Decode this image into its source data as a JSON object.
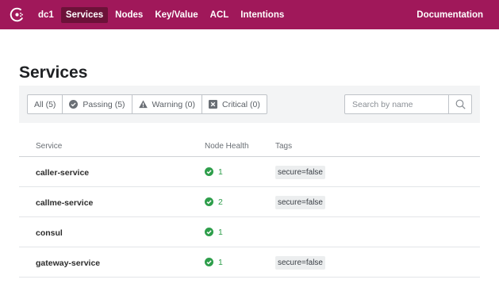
{
  "nav": {
    "logo_icon": "consul-logo-icon",
    "datacenter": "dc1",
    "items": [
      {
        "label": "Services",
        "active": true
      },
      {
        "label": "Nodes",
        "active": false
      },
      {
        "label": "Key/Value",
        "active": false
      },
      {
        "label": "ACL",
        "active": false
      },
      {
        "label": "Intentions",
        "active": false
      }
    ],
    "documentation": "Documentation"
  },
  "page": {
    "title": "Services"
  },
  "filters": {
    "all": "All (5)",
    "passing": "Passing (5)",
    "warning": "Warning (0)",
    "critical": "Critical (0)"
  },
  "search": {
    "placeholder": "Search by name",
    "value": ""
  },
  "table": {
    "headers": {
      "service": "Service",
      "health": "Node Health",
      "tags": "Tags"
    },
    "rows": [
      {
        "name": "caller-service",
        "health": "1",
        "tag": "secure=false"
      },
      {
        "name": "callme-service",
        "health": "2",
        "tag": "secure=false"
      },
      {
        "name": "consul",
        "health": "1",
        "tag": ""
      },
      {
        "name": "gateway-service",
        "health": "1",
        "tag": "secure=false"
      }
    ]
  },
  "colors": {
    "nav_bg": "#a0185a",
    "nav_active": "#6c1239",
    "passing": "#2e9e4b"
  }
}
